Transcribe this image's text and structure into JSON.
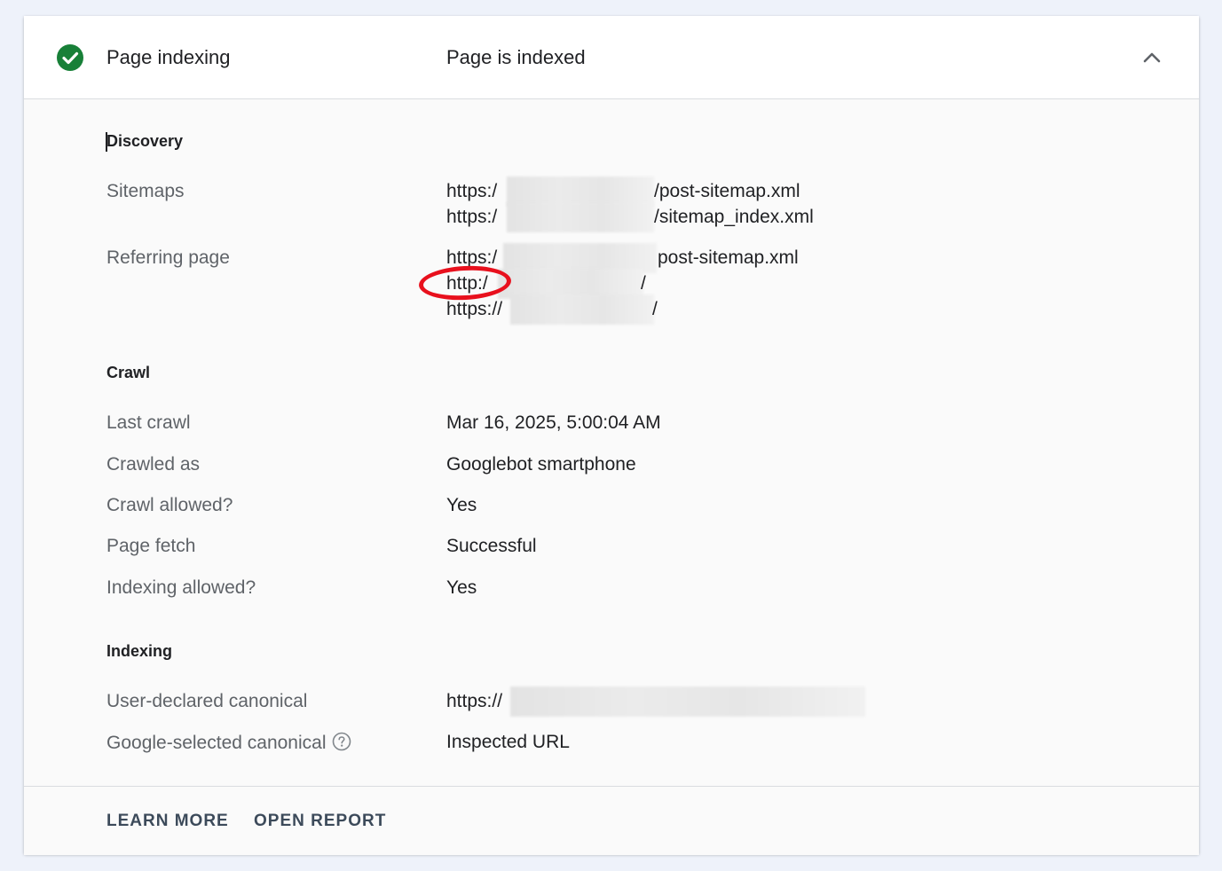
{
  "header": {
    "title": "Page indexing",
    "status": "Page is indexed",
    "status_color": "#188038"
  },
  "discovery": {
    "section_title": "Discovery",
    "sitemaps_label": "Sitemaps",
    "sitemaps": [
      {
        "prefix": "https:/",
        "suffix": "/post-sitemap.xml"
      },
      {
        "prefix": "https:/",
        "suffix": "/sitemap_index.xml"
      }
    ],
    "referring_label": "Referring page",
    "referring": [
      {
        "prefix": "https:/",
        "suffix": "post-sitemap.xml"
      },
      {
        "prefix": "http:/",
        "suffix": "/"
      },
      {
        "prefix": "https://",
        "suffix": "/"
      }
    ]
  },
  "crawl": {
    "section_title": "Crawl",
    "rows": [
      {
        "label": "Last crawl",
        "value": "Mar 16, 2025, 5:00:04 AM"
      },
      {
        "label": "Crawled as",
        "value": "Googlebot smartphone"
      },
      {
        "label": "Crawl allowed?",
        "value": "Yes"
      },
      {
        "label": "Page fetch",
        "value": "Successful"
      },
      {
        "label": "Indexing allowed?",
        "value": "Yes"
      }
    ]
  },
  "indexing": {
    "section_title": "Indexing",
    "user_canonical_label": "User-declared canonical",
    "user_canonical_prefix": "https://",
    "google_canonical_label": "Google-selected canonical",
    "google_canonical_value": "Inspected URL"
  },
  "footer": {
    "learn_more": "LEARN MORE",
    "open_report": "OPEN REPORT"
  },
  "icons": {
    "check": "check-circle-icon",
    "collapse": "chevron-up-icon",
    "help": "help-circle-icon"
  },
  "annotation_color": "#e8101d"
}
